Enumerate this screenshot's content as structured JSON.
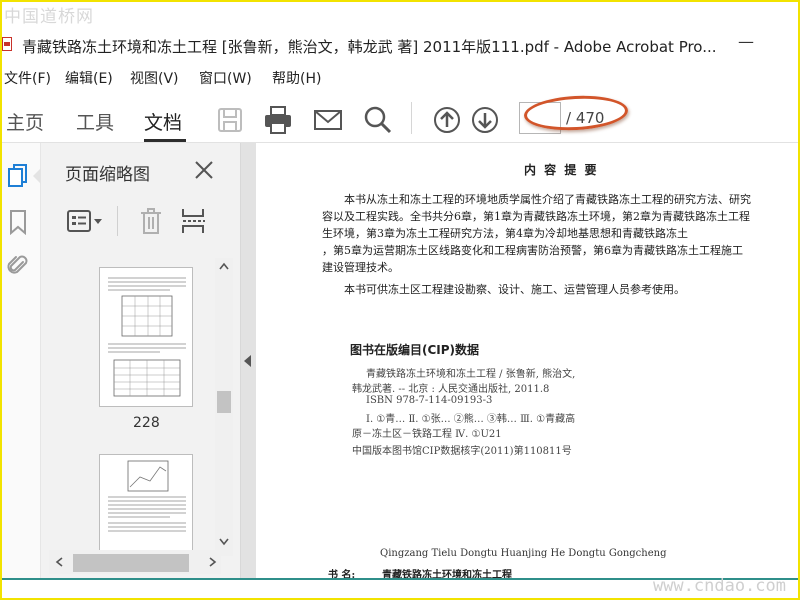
{
  "watermark": {
    "top": "中国道桥网",
    "bottom": "www.cndao.com"
  },
  "window": {
    "title": "青藏铁路冻土环境和冻土工程 [张鲁新，熊治文，韩龙武 著] 2011年版111.pdf - Adobe Acrobat Pro...",
    "minimize": "—"
  },
  "menu": {
    "items": [
      "文件(F)",
      "编辑(E)",
      "视图(V)",
      "窗口(W)",
      "帮助(H)"
    ]
  },
  "toolbar": {
    "tabs": [
      "主页",
      "工具",
      "文档"
    ],
    "active_tab": "文档",
    "icons": [
      "save-icon",
      "print-icon",
      "email-icon",
      "search-icon",
      "page-up-icon",
      "page-down-icon"
    ],
    "page_input_value": "",
    "page_total": "/ 470"
  },
  "sidebar": {
    "rail_icons": [
      "page-thumbnails-icon",
      "bookmark-icon",
      "attachment-icon"
    ],
    "panel_title": "页面缩略图",
    "tool_icons": [
      "thumbnail-options-icon",
      "delete-page-icon",
      "insert-page-icon"
    ],
    "thumbnails": [
      {
        "label": "228"
      },
      {
        "label": ""
      }
    ]
  },
  "document": {
    "heading": "内  容  提  要",
    "summary_lines": [
      "本书从冻土和冻土工程的环境地质学属性介绍了青藏铁路冻土工程的研究方法、研究",
      "容以及工程实践。全书共分6章，第1章为青藏铁路冻土环境，第2章为青藏铁路冻土工程",
      "生环境，第3章为冻土工程研究方法，第4章为冷却地基思想和青藏铁路冻土",
      "，第5章为运营期冻土区线路变化和工程病害防治预警，第6章为青藏铁路冻土工程施工",
      "建设管理技术。",
      "本书可供冻土区工程建设勘察、设计、施工、运营管理人员参考使用。"
    ],
    "cip_title": "图书在版编目(CIP)数据",
    "cip_lines": [
      "青藏铁路冻土环境和冻土工程 / 张鲁新, 熊治文,",
      "韩龙武著. -- 北京 : 人民交通出版社, 2011.8",
      "ISBN 978-7-114-09193-3",
      "Ⅰ. ①青… Ⅱ. ①张… ②熊… ③韩… Ⅲ. ①青藏高",
      "原－冻土区－铁路工程 Ⅳ. ①U21",
      "中国版本图书馆CIP数据核字(2011)第110811号"
    ],
    "pinyin": "Qingzang Tielu Dongtu Huanjing He Dongtu Gongcheng",
    "book_name_label": "书    名:",
    "book_name": "青藏铁路冻土环境和冻土工程"
  },
  "colors": {
    "frame": "#f2e300",
    "highlight": "#d2552a",
    "bottom_line": "#2f8f8a"
  }
}
